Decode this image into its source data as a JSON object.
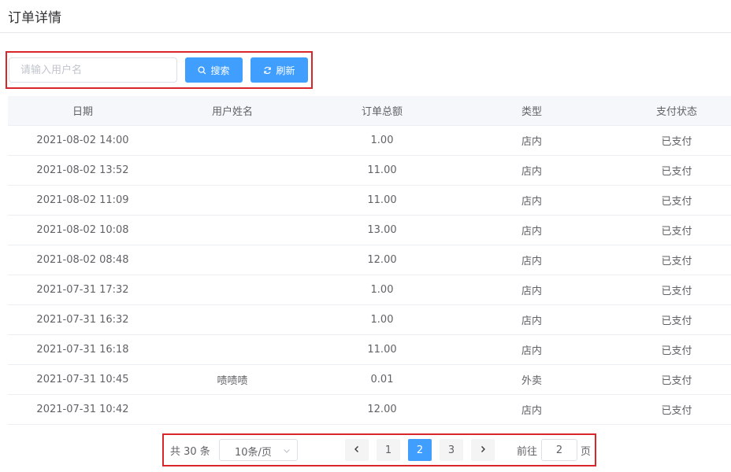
{
  "page": {
    "title": "订单详情"
  },
  "search": {
    "placeholder": "请输入用户名",
    "value": "",
    "search_label": "搜索",
    "refresh_label": "刷新",
    "accent": "#409eff"
  },
  "table": {
    "headers": [
      "日期",
      "用户姓名",
      "订单总额",
      "类型",
      "支付状态"
    ],
    "rows": [
      {
        "date": "2021-08-02 14:00",
        "user": "",
        "total": "1.00",
        "type": "店内",
        "status": "已支付"
      },
      {
        "date": "2021-08-02 13:52",
        "user": "",
        "total": "11.00",
        "type": "店内",
        "status": "已支付"
      },
      {
        "date": "2021-08-02 11:09",
        "user": "",
        "total": "11.00",
        "type": "店内",
        "status": "已支付"
      },
      {
        "date": "2021-08-02 10:08",
        "user": "",
        "total": "13.00",
        "type": "店内",
        "status": "已支付"
      },
      {
        "date": "2021-08-02 08:48",
        "user": "",
        "total": "12.00",
        "type": "店内",
        "status": "已支付"
      },
      {
        "date": "2021-07-31 17:32",
        "user": "",
        "total": "1.00",
        "type": "店内",
        "status": "已支付"
      },
      {
        "date": "2021-07-31 16:32",
        "user": "",
        "total": "1.00",
        "type": "店内",
        "status": "已支付"
      },
      {
        "date": "2021-07-31 16:18",
        "user": "",
        "total": "11.00",
        "type": "店内",
        "status": "已支付"
      },
      {
        "date": "2021-07-31 10:45",
        "user": "啧啧啧",
        "total": "0.01",
        "type": "外卖",
        "status": "已支付"
      },
      {
        "date": "2021-07-31 10:42",
        "user": "",
        "total": "12.00",
        "type": "店内",
        "status": "已支付"
      }
    ]
  },
  "pagination": {
    "total_label": "共 30 条",
    "page_size_label": "10条/页",
    "pages": [
      "1",
      "2",
      "3"
    ],
    "current_page": "2",
    "jump_prefix": "前往",
    "jump_value": "2",
    "jump_suffix": "页"
  }
}
